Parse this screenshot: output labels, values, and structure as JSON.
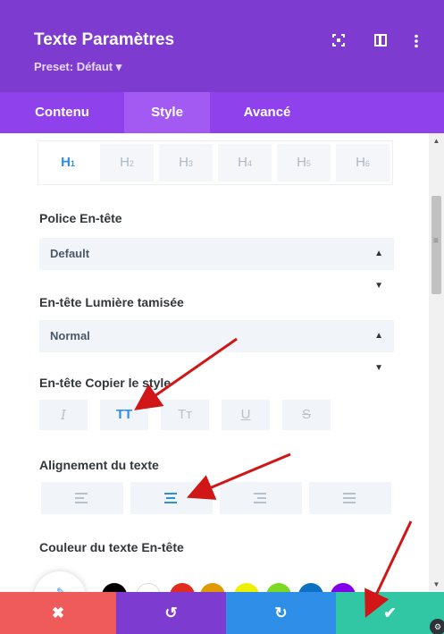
{
  "colors": {
    "header": "#7e3bd0",
    "tabs": "#8f42ec",
    "active_tab": "#a25af2",
    "cancel": "#ef5a5a",
    "undo": "#7e3bd0",
    "redo": "#2f8ee8",
    "save": "#31c7a4",
    "accent": "#2d8ee6",
    "arrow": "#d01616"
  },
  "header": {
    "title": "Texte Paramètres",
    "preset": "Preset: Défaut ▾",
    "icons": [
      "expand-icon",
      "split-view-icon",
      "more-options-icon"
    ]
  },
  "tabs": [
    {
      "label": "Contenu",
      "active": false
    },
    {
      "label": "Style",
      "active": true
    },
    {
      "label": "Avancé",
      "active": false
    }
  ],
  "heading_levels": [
    {
      "label": "H",
      "sub": "1",
      "active": true
    },
    {
      "label": "H",
      "sub": "2",
      "active": false
    },
    {
      "label": "H",
      "sub": "3",
      "active": false
    },
    {
      "label": "H",
      "sub": "4",
      "active": false
    },
    {
      "label": "H",
      "sub": "5",
      "active": false
    },
    {
      "label": "H",
      "sub": "6",
      "active": false
    }
  ],
  "fields": {
    "font_label": "Police En-tête",
    "font_value": "Default",
    "weight_label": "En-tête Lumière tamisée",
    "weight_value": "Normal",
    "style_label": "En-tête Copier le style",
    "style_buttons": [
      {
        "label": "I",
        "icon": "italic-icon",
        "active": false
      },
      {
        "label": "TT",
        "icon": "uppercase-icon",
        "active": true
      },
      {
        "label": "Tт",
        "icon": "capitalize-icon",
        "active": false
      },
      {
        "label": "U",
        "icon": "underline-icon",
        "active": false
      },
      {
        "label": "S",
        "icon": "strikethrough-icon",
        "active": false
      }
    ],
    "align_label": "Alignement du texte",
    "align_buttons": [
      {
        "icon": "align-left-icon",
        "active": false
      },
      {
        "icon": "align-center-icon",
        "active": true
      },
      {
        "icon": "align-right-icon",
        "active": false
      },
      {
        "icon": "align-justify-icon",
        "active": false
      }
    ],
    "color_label": "Couleur du texte En-tête",
    "swatches": [
      "#000000",
      "#ffffff",
      "#e02b20",
      "#e09900",
      "#edf000",
      "#7cda24",
      "#0c71c3",
      "#8300e9"
    ]
  },
  "footer": {
    "cancel": "✖",
    "undo": "↺",
    "redo": "↻",
    "save": "✔"
  }
}
